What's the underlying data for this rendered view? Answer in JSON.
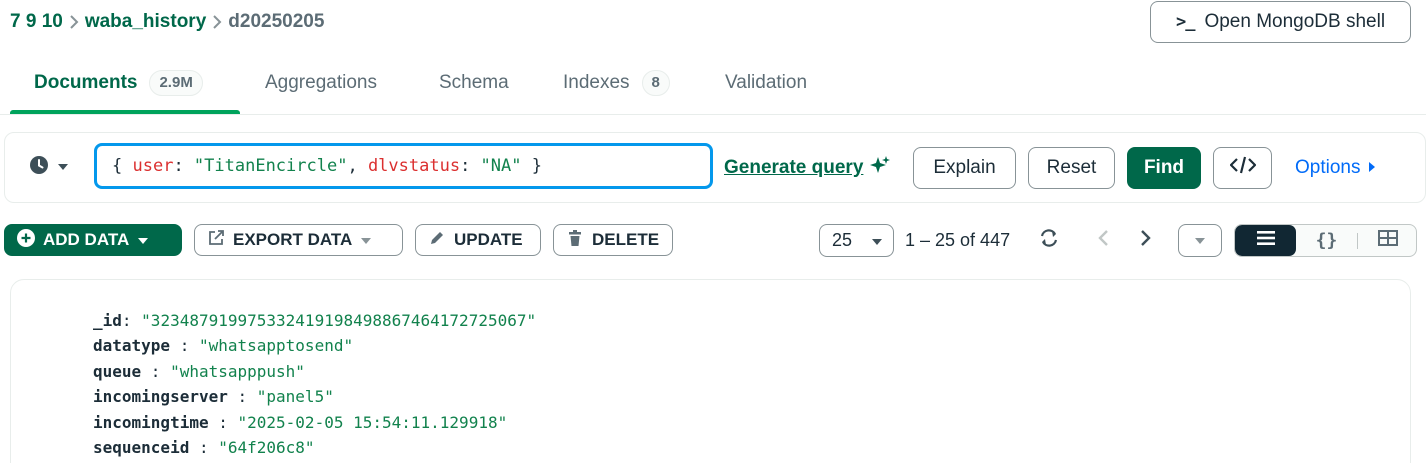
{
  "breadcrumb": {
    "host": "7 9 10",
    "database": "waba_history",
    "collection": "d20250205"
  },
  "shell_button": {
    "label": "Open MongoDB shell",
    "icon": "terminal-prompt-icon"
  },
  "tabs": [
    {
      "label": "Documents",
      "count": "2.9M",
      "active": true
    },
    {
      "label": "Aggregations"
    },
    {
      "label": "Schema"
    },
    {
      "label": "Indexes",
      "count": "8"
    },
    {
      "label": "Validation"
    }
  ],
  "query": {
    "open": "{ ",
    "key1": "user",
    "colon1": ": ",
    "val1": "\"TitanEncircle\"",
    "comma": ", ",
    "key2": "dlvstatus",
    "colon2": ": ",
    "val2": "\"NA\"",
    "close": " }",
    "generate_label": "Generate query",
    "explain_label": "Explain",
    "reset_label": "Reset",
    "find_label": "Find",
    "options_label": "Options"
  },
  "actions": {
    "add_data": "ADD DATA",
    "export_data": "EXPORT DATA",
    "update": "UPDATE",
    "delete": "DELETE"
  },
  "pagination": {
    "page_size": "25",
    "range_label": "1 – 25 of 447"
  },
  "document": {
    "fields": [
      {
        "name": "_id",
        "value": "\"3234879199753324191984988674641727250 67\""
      },
      {
        "name": "datatype",
        "value": "\"whatsapptosend\""
      },
      {
        "name": "queue",
        "value": "\"whatsapppush\""
      },
      {
        "name": "incomingserver",
        "value": "\"panel5\""
      },
      {
        "name": "incomingtime",
        "value": "\"2025-02-05 15:54:11.129918\""
      },
      {
        "name": "sequenceid",
        "value": "\"64f206c8\""
      }
    ]
  },
  "colors": {
    "brand_green": "#00684a",
    "tab_underline": "#00a35c",
    "focus_blue": "#0498ec",
    "link_blue": "#016bf8",
    "string_green": "#12824d",
    "key_red": "#db3030"
  }
}
